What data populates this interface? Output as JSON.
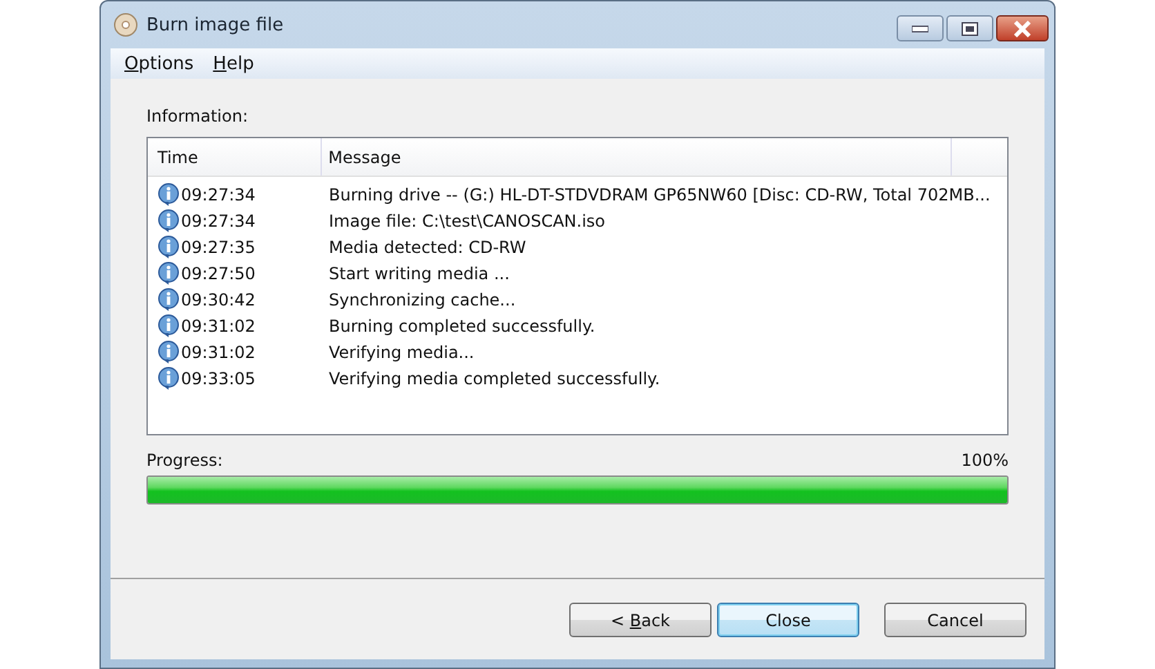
{
  "window": {
    "title": "Burn image file"
  },
  "menu": [
    {
      "accel": "O",
      "after": "ptions"
    },
    {
      "accel": "H",
      "after": "elp"
    }
  ],
  "information": {
    "label": "Information:",
    "columns": [
      "Time",
      "Message"
    ],
    "rows": [
      {
        "time": "09:27:34",
        "message": "Burning drive -- (G:) HL-DT-STDVDRAM GP65NW60 [Disc: CD-RW, Total 702MB..."
      },
      {
        "time": "09:27:34",
        "message": "Image file:  C:\\test\\CANOSCAN.iso"
      },
      {
        "time": "09:27:35",
        "message": "Media detected: CD-RW"
      },
      {
        "time": "09:27:50",
        "message": "Start writing media ..."
      },
      {
        "time": "09:30:42",
        "message": "Synchronizing cache..."
      },
      {
        "time": "09:31:02",
        "message": "Burning completed successfully."
      },
      {
        "time": "09:31:02",
        "message": "Verifying media..."
      },
      {
        "time": "09:33:05",
        "message": "Verifying media completed successfully."
      }
    ]
  },
  "progress": {
    "label": "Progress:",
    "reading": "100%",
    "level": 1
  },
  "buttons": [
    {
      "before": "< ",
      "accel": "B",
      "after": "ack",
      "default": false
    },
    {
      "label": "Close",
      "default": true
    },
    {
      "label": "Cancel",
      "default": false
    }
  ]
}
